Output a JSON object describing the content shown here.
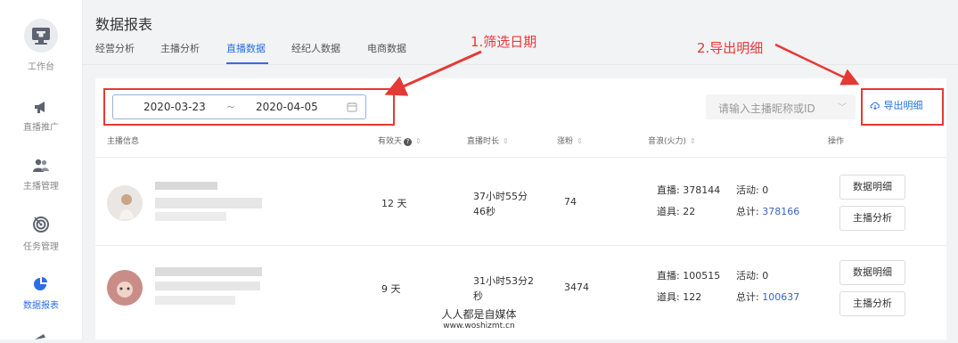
{
  "sidebar": {
    "items": [
      {
        "label": "工作台",
        "icon": "monitor-icon"
      },
      {
        "label": "直播推广",
        "icon": "megaphone-icon"
      },
      {
        "label": "主播管理",
        "icon": "user-icon"
      },
      {
        "label": "任务管理",
        "icon": "target-icon"
      },
      {
        "label": "数据报表",
        "icon": "pie-chart-icon",
        "active": true
      }
    ]
  },
  "header": {
    "title": "数据报表"
  },
  "tabs": [
    {
      "label": "经营分析"
    },
    {
      "label": "主播分析"
    },
    {
      "label": "直播数据",
      "active": true
    },
    {
      "label": "经纪人数据"
    },
    {
      "label": "电商数据"
    }
  ],
  "filters": {
    "date_start": "2020-03-23",
    "date_sep": "~",
    "date_end": "2020-04-05",
    "search_placeholder": "请输入主播昵称或ID",
    "export_label": "导出明细"
  },
  "annotations": {
    "filter_date": "1.筛选日期",
    "export_detail": "2.导出明细"
  },
  "table": {
    "columns": [
      "主播信息",
      "有效天",
      "直播时长",
      "涨粉",
      "音浪(火力)",
      "操作"
    ],
    "rows": [
      {
        "valid_days": "12 天",
        "duration_line1": "37小时55分",
        "duration_line2": "46秒",
        "fans": "74",
        "live_label": "直播: 378144",
        "activity_label": "活动: 0",
        "props_label": "道具: 22",
        "total_prefix": "总计: ",
        "total_value": "378166",
        "action1": "数据明细",
        "action2": "主播分析"
      },
      {
        "valid_days": "9 天",
        "duration_line1": "31小时53分2",
        "duration_line2": "秒",
        "fans": "3474",
        "live_label": "直播: 100515",
        "activity_label": "活动: 0",
        "props_label": "道具: 122",
        "total_prefix": "总计: ",
        "total_value": "100637",
        "action1": "数据明细",
        "action2": "主播分析"
      }
    ]
  },
  "watermark": {
    "line1": "人人都是自媒体",
    "line2": "www.woshizmt.cn"
  },
  "colors": {
    "accent": "#2b6fe6",
    "annotation": "#e53935"
  }
}
